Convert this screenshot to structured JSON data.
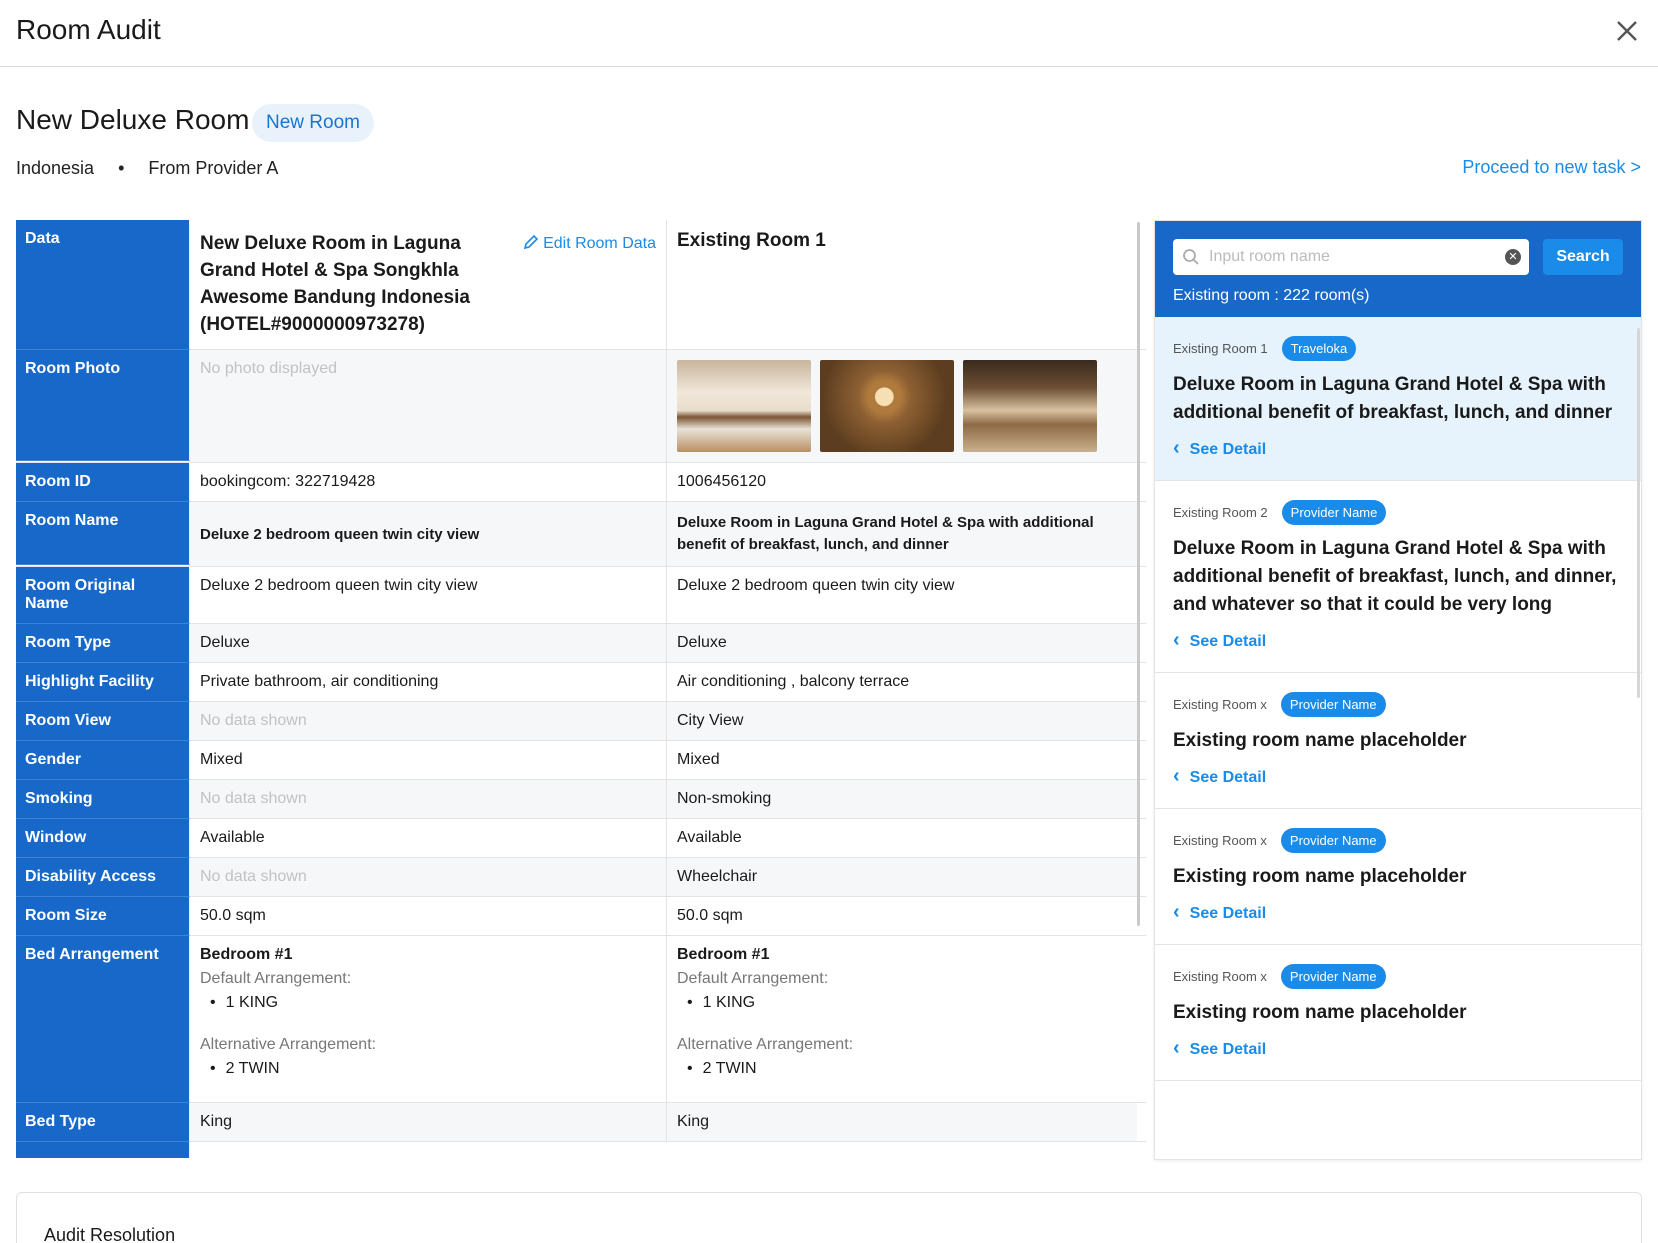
{
  "header": {
    "title": "Room Audit"
  },
  "room": {
    "title": "New Deluxe Room",
    "badge": "New Room",
    "country": "Indonesia",
    "separator": "•",
    "provider": "From Provider A",
    "proceed": "Proceed to new task >"
  },
  "table": {
    "data_label": "Data",
    "new_room_name": "New Deluxe Room in Laguna Grand Hotel & Spa Songkhla Awesome Bandung Indonesia (HOTEL#9000000973278)",
    "edit_label": "Edit Room Data",
    "existing_title": "Existing Room 1",
    "photo_label": "Room Photo",
    "no_photo": "No photo displayed",
    "rows": [
      {
        "label": "Room ID",
        "new": "bookingcom: 322719428",
        "existing": "1006456120"
      },
      {
        "label": "Room Name",
        "new": "Deluxe 2 bedroom queen twin city view",
        "existing": "Deluxe Room in Laguna Grand Hotel & Spa with additional benefit of breakfast, lunch, and dinner"
      },
      {
        "label": "Room Original Name",
        "new": "Deluxe 2 bedroom queen twin city view",
        "existing": "Deluxe 2 bedroom queen twin city view"
      },
      {
        "label": "Room Type",
        "new": "Deluxe",
        "existing": "Deluxe"
      },
      {
        "label": "Highlight Facility",
        "new": "Private bathroom, air conditioning",
        "existing": "Air conditioning , balcony terrace"
      },
      {
        "label": "Room View",
        "new": "No data shown",
        "existing": "City View"
      },
      {
        "label": "Gender",
        "new": "Mixed",
        "existing": "Mixed"
      },
      {
        "label": "Smoking",
        "new": "No data shown",
        "existing": "Non-smoking"
      },
      {
        "label": "Window",
        "new": "Available",
        "existing": "Available"
      },
      {
        "label": "Disability Access",
        "new": "No data shown",
        "existing": "Wheelchair"
      },
      {
        "label": "Room Size",
        "new": "50.0 sqm",
        "existing": "50.0 sqm"
      }
    ],
    "bed": {
      "label": "Bed Arrangement",
      "bedroom": "Bedroom #1",
      "default_label": "Default Arrangement:",
      "default_value": "1 KING",
      "alt_label": "Alternative Arrangement:",
      "alt_value": "2 TWIN"
    },
    "bed_type": {
      "label": "Bed Type",
      "new": "King",
      "existing": "King"
    }
  },
  "panel": {
    "search_placeholder": "Input room name",
    "search_button": "Search",
    "count": "Existing room : 222 room(s)",
    "see_detail": "See Detail",
    "cards": [
      {
        "label": "Existing Room 1",
        "provider": "Traveloka",
        "name": "Deluxe Room in Laguna Grand Hotel & Spa with additional benefit of breakfast, lunch, and dinner",
        "selected": true
      },
      {
        "label": "Existing Room 2",
        "provider": "Provider Name",
        "name": "Deluxe Room in Laguna Grand Hotel & Spa with additional benefit of breakfast, lunch, and dinner, and whatever so that it could be very long",
        "selected": false
      },
      {
        "label": "Existing Room x",
        "provider": "Provider Name",
        "name": "Existing room name placeholder",
        "selected": false
      },
      {
        "label": "Existing Room x",
        "provider": "Provider Name",
        "name": "Existing room name placeholder",
        "selected": false
      },
      {
        "label": "Existing Room x",
        "provider": "Provider Name",
        "name": "Existing room name placeholder",
        "selected": false
      }
    ]
  },
  "audit": {
    "title": "Audit Resolution"
  },
  "colors": {
    "primary": "#1768c9",
    "accent": "#1a8be8",
    "selected_bg": "#e6f2fc"
  },
  "icons": {
    "close": "close-icon",
    "edit": "pencil-icon",
    "search": "search-icon",
    "clear": "clear-icon",
    "chevron": "chevron-left-icon"
  }
}
